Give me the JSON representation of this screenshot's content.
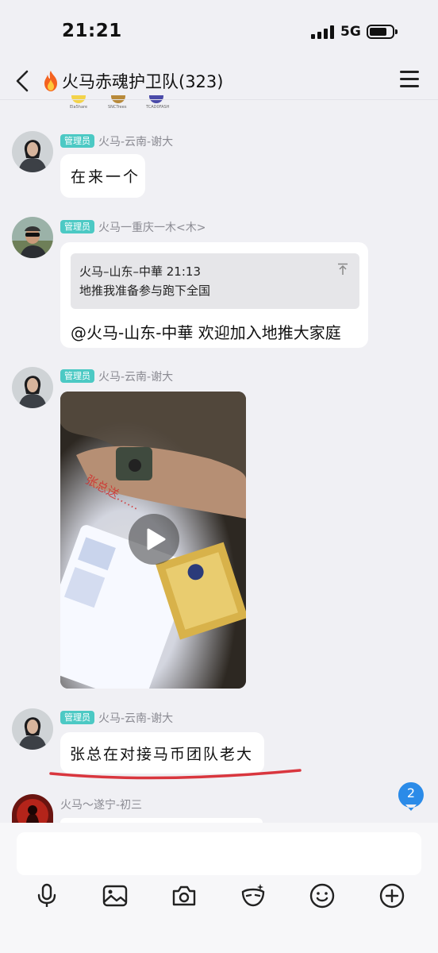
{
  "status": {
    "time": "21:21",
    "network": "5G"
  },
  "header": {
    "title": "火马赤魂护卫队(323)"
  },
  "top_partial_labels": [
    "Ela5hare",
    "SNCTrees",
    "TCAD0FASH"
  ],
  "messages": [
    {
      "badge": "管理员",
      "sender": "火马-云南-谢大",
      "text": "在来一个"
    },
    {
      "badge": "管理员",
      "sender": "火马一重庆一木<木>",
      "quote": {
        "head": "火马–山东–中華 21:13",
        "body": "地推我准备参与跑下全国"
      },
      "text": "@火马-山东-中華 欢迎加入地推大家庭"
    },
    {
      "badge": "管理员",
      "sender": "火马-云南-谢大",
      "video_watermark": "张总送……"
    },
    {
      "badge": "管理员",
      "sender": "火马-云南-谢大",
      "text": "张总在对接马币团队老大"
    },
    {
      "sender": "火马～遂宁-初三"
    }
  ],
  "unread_count": "2",
  "input": {
    "placeholder": ""
  },
  "toolbar": [
    "microphone-icon",
    "image-icon",
    "camera-icon",
    "magic-mask-icon",
    "emoji-icon",
    "plus-icon"
  ],
  "colors": {
    "admin_badge": "#4cc9c4",
    "unread_badge": "#2b8be8",
    "underline": "#d9363e"
  }
}
